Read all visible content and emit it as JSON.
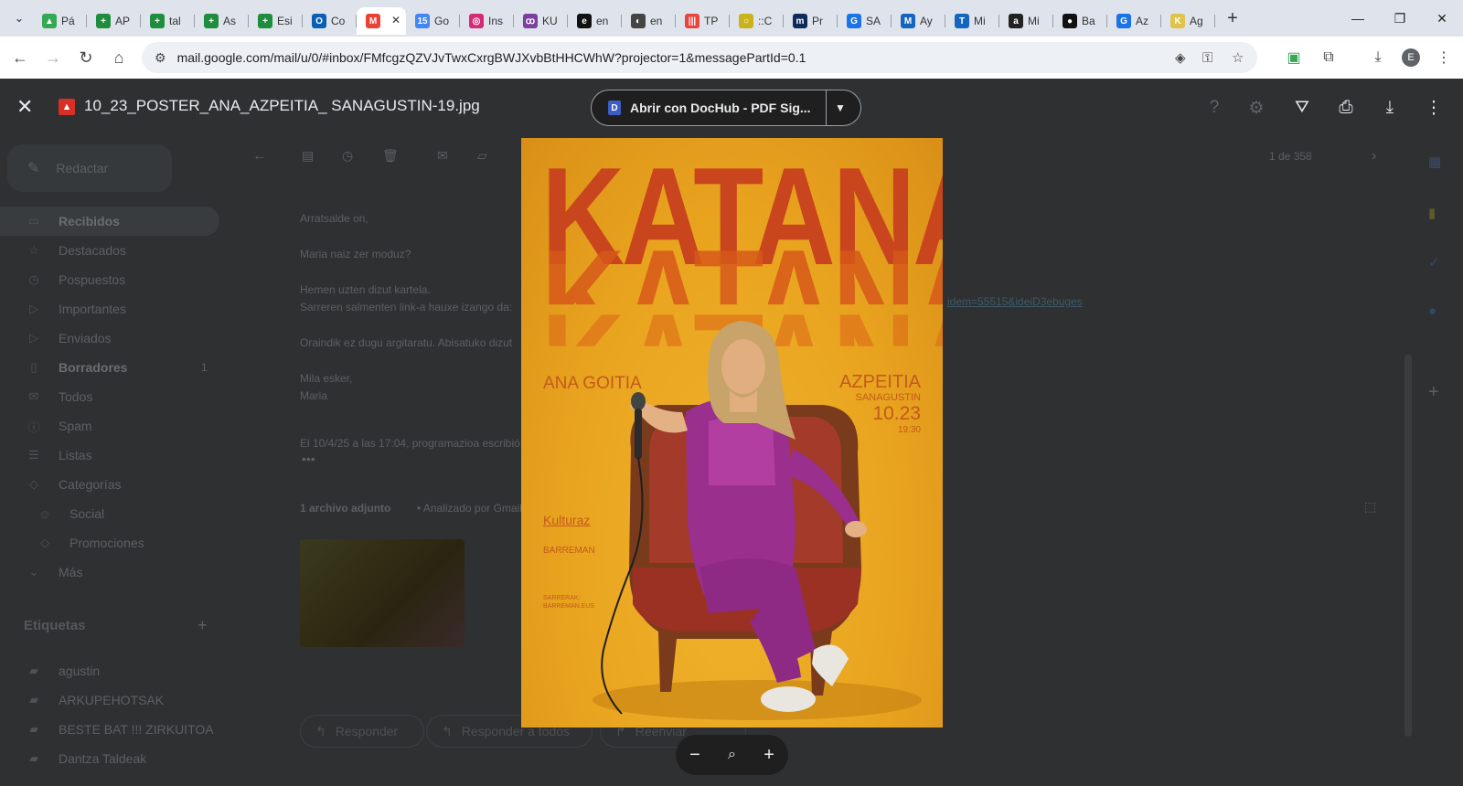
{
  "browser": {
    "tabs": [
      {
        "label": "Pá",
        "color": "#34a853",
        "glyph": "▲"
      },
      {
        "label": "AP",
        "color": "#1e8e3e",
        "glyph": "+"
      },
      {
        "label": "tal",
        "color": "#1e8e3e",
        "glyph": "+"
      },
      {
        "label": "As",
        "color": "#1e8e3e",
        "glyph": "+"
      },
      {
        "label": "Esi",
        "color": "#1e8e3e",
        "glyph": "+"
      },
      {
        "label": "Co",
        "color": "#0a5fb4",
        "glyph": "O"
      },
      {
        "label": "",
        "color": "#ea4335",
        "glyph": "M",
        "active": true
      },
      {
        "label": "Go",
        "color": "#4285f4",
        "glyph": "15"
      },
      {
        "label": "Ins",
        "color": "#d62976",
        "glyph": "◎"
      },
      {
        "label": "KU",
        "color": "#7b3fa0",
        "glyph": "ꝏ"
      },
      {
        "label": "en",
        "color": "#111111",
        "glyph": "e"
      },
      {
        "label": "en",
        "color": "#444444",
        "glyph": "◐"
      },
      {
        "label": "TP",
        "color": "#e8453c",
        "glyph": "|||"
      },
      {
        "label": "::C",
        "color": "#c9b21b",
        "glyph": "○"
      },
      {
        "label": "Pr",
        "color": "#0d2b5b",
        "glyph": "m"
      },
      {
        "label": "SA",
        "color": "#1a73e8",
        "glyph": "G"
      },
      {
        "label": "Ay",
        "color": "#1565c0",
        "glyph": "M"
      },
      {
        "label": "Mi",
        "color": "#1565c0",
        "glyph": "T"
      },
      {
        "label": "Mi",
        "color": "#222222",
        "glyph": "a"
      },
      {
        "label": "Ba",
        "color": "#111111",
        "glyph": "●"
      },
      {
        "label": "Az",
        "color": "#1a73e8",
        "glyph": "G"
      },
      {
        "label": "Ag",
        "color": "#e0c34a",
        "glyph": "K"
      }
    ],
    "url": "mail.google.com/mail/u/0/#inbox/FMfcgzQZVJvTwxCxrgBWJXvbBtHHCWhW?projector=1&messagePartId=0.1",
    "profile_initial": "E"
  },
  "gmail": {
    "compose_label": "Redactar",
    "sidebar": [
      {
        "label": "Recibidos",
        "icon": "▭",
        "active": true,
        "bold": true
      },
      {
        "label": "Destacados",
        "icon": "☆"
      },
      {
        "label": "Pospuestos",
        "icon": "◷"
      },
      {
        "label": "Importantes",
        "icon": "▷"
      },
      {
        "label": "Enviados",
        "icon": "▷"
      },
      {
        "label": "Borradores",
        "icon": "▯",
        "bold": true,
        "count": "1"
      },
      {
        "label": "Todos",
        "icon": "✉"
      },
      {
        "label": "Spam",
        "icon": "ⓘ"
      },
      {
        "label": "Listas",
        "icon": "☰"
      },
      {
        "label": "Categorías",
        "icon": "◇"
      },
      {
        "label": "Social",
        "icon": "☺",
        "indent": true
      },
      {
        "label": "Promociones",
        "icon": "◇",
        "indent": true
      },
      {
        "label": "Más",
        "icon": "⌄"
      }
    ],
    "labels_heading": "Etiquetas",
    "labels": [
      "agustin",
      "ARKUPEHOTSAK",
      "BESTE BAT !!! ZIRKUITOA",
      "Dantza Taldeak"
    ],
    "mail_lines": [
      "Arratsalde on,",
      "Maria naiz zer moduz?",
      "Hemen uzten dizut kartela.",
      "Sarreren salmenten link-a hauxe izango da:",
      "Oraindik ez dugu argitaratu. Abisatuko dizut",
      "Mila esker,",
      "Maria",
      "El 10/4/25 a las 17:04, programazioa escribió:"
    ],
    "link_fragment": "idem=55515&ideiD3ebuges",
    "attachment_label": "1 archivo adjunto",
    "attachment_scan": "• Analizado por Gmail",
    "page_count": "1 de 358",
    "reply_buttons": [
      "Responder",
      "Responder a todos",
      "Reenviar"
    ]
  },
  "viewer": {
    "filename": "10_23_POSTER_ANA_AZPEITIA_ SANAGUSTIN-19.jpg",
    "open_with": "Abrir con DocHub - PDF Sig...",
    "poster": {
      "title": "KATANA",
      "artist": "ANA GOITIA",
      "town": "AZPEITIA",
      "venue": "SANAGUSTIN",
      "date": "10.23",
      "time": "19:30",
      "sponsor1": "Kulturaz",
      "sponsor2": "BARREMAN",
      "tickets1": "SARRERAK:",
      "tickets2": "BARREMAN.EUS"
    }
  }
}
